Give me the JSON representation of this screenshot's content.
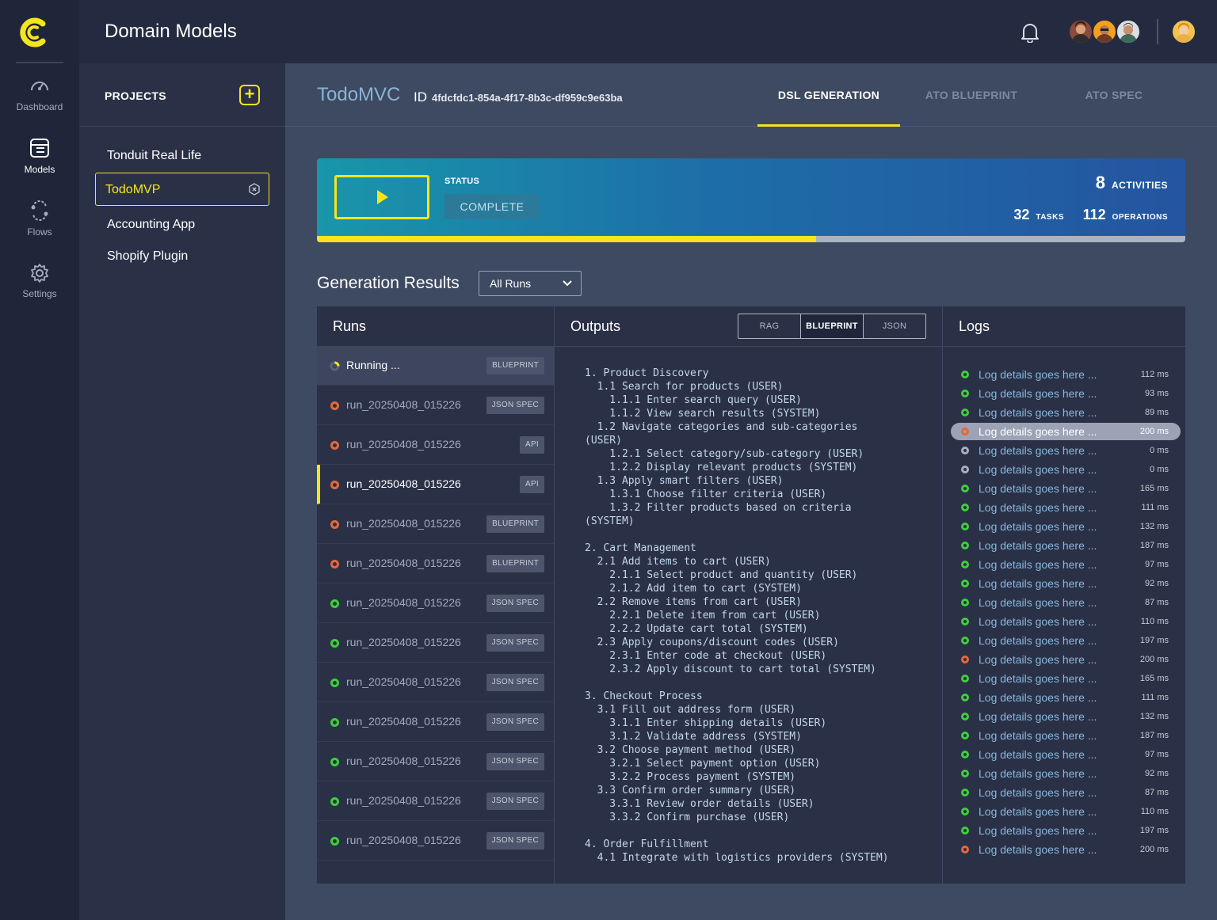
{
  "header": {
    "title": "Domain Models"
  },
  "rail": {
    "items": [
      {
        "label": "Dashboard",
        "icon": "gauge-icon"
      },
      {
        "label": "Models",
        "icon": "models-icon"
      },
      {
        "label": "Flows",
        "icon": "flows-icon"
      },
      {
        "label": "Settings",
        "icon": "gear-icon"
      }
    ],
    "active": "Models"
  },
  "projects": {
    "title": "PROJECTS",
    "add_label": "+",
    "items": [
      {
        "label": "Tonduit Real Life"
      },
      {
        "label": "TodoMVP"
      },
      {
        "label": "Accounting App"
      },
      {
        "label": "Shopify Plugin"
      }
    ],
    "active": "TodoMVP"
  },
  "project": {
    "name": "TodoMVC",
    "id_label": "ID",
    "id": "4fdcfdc1-854a-4f17-8b3c-df959c9e63ba"
  },
  "tabs": [
    {
      "label": "DSL GENERATION"
    },
    {
      "label": "ATO BLUEPRINT"
    },
    {
      "label": "ATO SPEC"
    }
  ],
  "status": {
    "label": "STATUS",
    "value": "COMPLETE",
    "activities": {
      "value": "8",
      "unit": "ACTIVITIES"
    },
    "tasks": {
      "value": "32",
      "unit": "TASKS"
    },
    "operations": {
      "value": "112",
      "unit": "OPERATIONS"
    },
    "progress": 0.575
  },
  "results": {
    "title": "Generation Results",
    "filter": "All Runs",
    "runs_header": "Runs",
    "outputs_header": "Outputs",
    "logs_header": "Logs",
    "formats": [
      "RAG",
      "BLUEPRINT",
      "JSON"
    ],
    "active_format": "BLUEPRINT",
    "runs": [
      {
        "name": "Running ...",
        "badge": "BLUEPRINT",
        "state": "running"
      },
      {
        "name": "run_20250408_015226",
        "badge": "JSON SPEC",
        "state": "error"
      },
      {
        "name": "run_20250408_015226",
        "badge": "API",
        "state": "error"
      },
      {
        "name": "run_20250408_015226",
        "badge": "API",
        "state": "error",
        "selected": true
      },
      {
        "name": "run_20250408_015226",
        "badge": "BLUEPRINT",
        "state": "error"
      },
      {
        "name": "run_20250408_015226",
        "badge": "BLUEPRINT",
        "state": "error"
      },
      {
        "name": "run_20250408_015226",
        "badge": "JSON SPEC",
        "state": "ok"
      },
      {
        "name": "run_20250408_015226",
        "badge": "JSON SPEC",
        "state": "ok"
      },
      {
        "name": "run_20250408_015226",
        "badge": "JSON SPEC",
        "state": "ok"
      },
      {
        "name": "run_20250408_015226",
        "badge": "JSON SPEC",
        "state": "ok"
      },
      {
        "name": "run_20250408_015226",
        "badge": "JSON SPEC",
        "state": "ok"
      },
      {
        "name": "run_20250408_015226",
        "badge": "JSON SPEC",
        "state": "ok"
      },
      {
        "name": "run_20250408_015226",
        "badge": "JSON SPEC",
        "state": "ok"
      }
    ],
    "output_lines": [
      "1. Product Discovery",
      "  1.1 Search for products (USER)",
      "    1.1.1 Enter search query (USER)",
      "    1.1.2 View search results (SYSTEM)",
      "  1.2 Navigate categories and sub-categories",
      "(USER)",
      "    1.2.1 Select category/sub-category (USER)",
      "    1.2.2 Display relevant products (SYSTEM)",
      "  1.3 Apply smart filters (USER)",
      "    1.3.1 Choose filter criteria (USER)",
      "    1.3.2 Filter products based on criteria",
      "(SYSTEM)",
      "",
      "2. Cart Management",
      "  2.1 Add items to cart (USER)",
      "    2.1.1 Select product and quantity (USER)",
      "    2.1.2 Add item to cart (SYSTEM)",
      "  2.2 Remove items from cart (USER)",
      "    2.2.1 Delete item from cart (USER)",
      "    2.2.2 Update cart total (SYSTEM)",
      "  2.3 Apply coupons/discount codes (USER)",
      "    2.3.1 Enter code at checkout (USER)",
      "    2.3.2 Apply discount to cart total (SYSTEM)",
      "",
      "3. Checkout Process",
      "  3.1 Fill out address form (USER)",
      "    3.1.1 Enter shipping details (USER)",
      "    3.1.2 Validate address (SYSTEM)",
      "  3.2 Choose payment method (USER)",
      "    3.2.1 Select payment option (USER)",
      "    3.2.2 Process payment (SYSTEM)",
      "  3.3 Confirm order summary (USER)",
      "    3.3.1 Review order details (USER)",
      "    3.3.2 Confirm purchase (USER)",
      "",
      "4. Order Fulfillment",
      "  4.1 Integrate with logistics providers (SYSTEM)"
    ],
    "logs": [
      {
        "text": "Log details goes here ...",
        "ms": "112 ms",
        "state": "ok"
      },
      {
        "text": "Log details goes here ...",
        "ms": "93 ms",
        "state": "ok"
      },
      {
        "text": "Log details goes here ...",
        "ms": "89 ms",
        "state": "ok"
      },
      {
        "text": "Log details goes here ...",
        "ms": "200 ms",
        "state": "err",
        "highlight": true
      },
      {
        "text": "Log details goes here ...",
        "ms": "0 ms",
        "state": "idle"
      },
      {
        "text": "Log details goes here ...",
        "ms": "0 ms",
        "state": "idle"
      },
      {
        "text": "Log details goes here ...",
        "ms": "165 ms",
        "state": "ok"
      },
      {
        "text": "Log details goes here ...",
        "ms": "111 ms",
        "state": "ok"
      },
      {
        "text": "Log details goes here ...",
        "ms": "132 ms",
        "state": "ok"
      },
      {
        "text": "Log details goes here ...",
        "ms": "187 ms",
        "state": "ok"
      },
      {
        "text": "Log details goes here ...",
        "ms": "97 ms",
        "state": "ok"
      },
      {
        "text": "Log details goes here ...",
        "ms": "92 ms",
        "state": "ok"
      },
      {
        "text": "Log details goes here ...",
        "ms": "87 ms",
        "state": "ok"
      },
      {
        "text": "Log details goes here ...",
        "ms": "110 ms",
        "state": "ok"
      },
      {
        "text": "Log details goes here ...",
        "ms": "197 ms",
        "state": "ok"
      },
      {
        "text": "Log details goes here ...",
        "ms": "200 ms",
        "state": "err"
      },
      {
        "text": "Log details goes here ...",
        "ms": "165 ms",
        "state": "ok"
      },
      {
        "text": "Log details goes here ...",
        "ms": "111 ms",
        "state": "ok"
      },
      {
        "text": "Log details goes here ...",
        "ms": "132 ms",
        "state": "ok"
      },
      {
        "text": "Log details goes here ...",
        "ms": "187 ms",
        "state": "ok"
      },
      {
        "text": "Log details goes here ...",
        "ms": "97 ms",
        "state": "ok"
      },
      {
        "text": "Log details goes here ...",
        "ms": "92 ms",
        "state": "ok"
      },
      {
        "text": "Log details goes here ...",
        "ms": "87 ms",
        "state": "ok"
      },
      {
        "text": "Log details goes here ...",
        "ms": "110 ms",
        "state": "ok"
      },
      {
        "text": "Log details goes here ...",
        "ms": "197 ms",
        "state": "ok"
      },
      {
        "text": "Log details goes here ...",
        "ms": "200 ms",
        "state": "err"
      }
    ]
  },
  "colors": {
    "accent": "#f6e51c",
    "ok": "#3ecf3a",
    "error": "#e8673a",
    "idle": "#aab0bd"
  }
}
